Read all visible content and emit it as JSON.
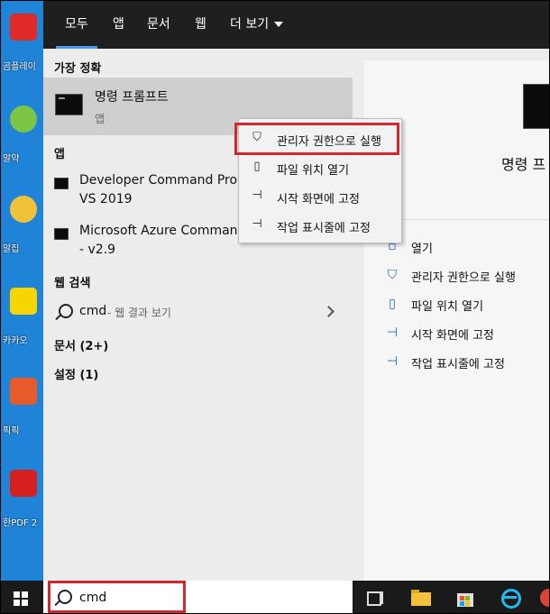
{
  "tabs": [
    {
      "label": "모두",
      "active": true
    },
    {
      "label": "앱"
    },
    {
      "label": "문서"
    },
    {
      "label": "웹"
    },
    {
      "label": "더 보기"
    }
  ],
  "sections": {
    "best_match": "가장 정확",
    "apps": "앱",
    "web_search": "웹 검색",
    "documents": "문서 (2+)",
    "settings": "설정 (1)"
  },
  "best_match": {
    "title": "명령 프롬프트",
    "subtitle": "앱"
  },
  "apps": [
    {
      "line1": "Developer Command Pron",
      "line2": "VS 2019"
    },
    {
      "line1": "Microsoft Azure Command",
      "line2": "- v2.9"
    }
  ],
  "web_result": {
    "query": "cmd",
    "suffix": " - 웹 결과 보기"
  },
  "context_menu": [
    {
      "label": "관리자 권한으로 실행",
      "icon": "shield-icon"
    },
    {
      "label": "파일 위치 열기",
      "icon": "folder-icon"
    },
    {
      "label": "시작 화면에 고정",
      "icon": "pin-icon"
    },
    {
      "label": "작업 표시줄에 고정",
      "icon": "pin-icon"
    }
  ],
  "right_pane": {
    "title": "명령 프",
    "actions": [
      {
        "label": "열기",
        "icon": "open-icon"
      },
      {
        "label": "관리자 권한으로 실행",
        "icon": "shield-icon"
      },
      {
        "label": "파일 위치 열기",
        "icon": "folder-icon"
      },
      {
        "label": "시작 화면에 고정",
        "icon": "pin-icon"
      },
      {
        "label": "작업 표시줄에 고정",
        "icon": "pin-icon"
      }
    ]
  },
  "desktop_icons": [
    {
      "label": "곰플레이",
      "color": "#e02a2a"
    },
    {
      "label": "알약",
      "color": "#7cc443"
    },
    {
      "label": "알집",
      "color": "#f0c23a"
    },
    {
      "label": "카카오",
      "color": "#f7d500"
    },
    {
      "label": "픽픽",
      "color": "#e85a2a"
    },
    {
      "label": "한PDF 2",
      "color": "#d62020"
    }
  ],
  "search": {
    "value": "cmd"
  },
  "colors": {
    "highlight": "#d3262d",
    "accent": "#1a66c8",
    "tab_underline": "#4a9cf0"
  }
}
